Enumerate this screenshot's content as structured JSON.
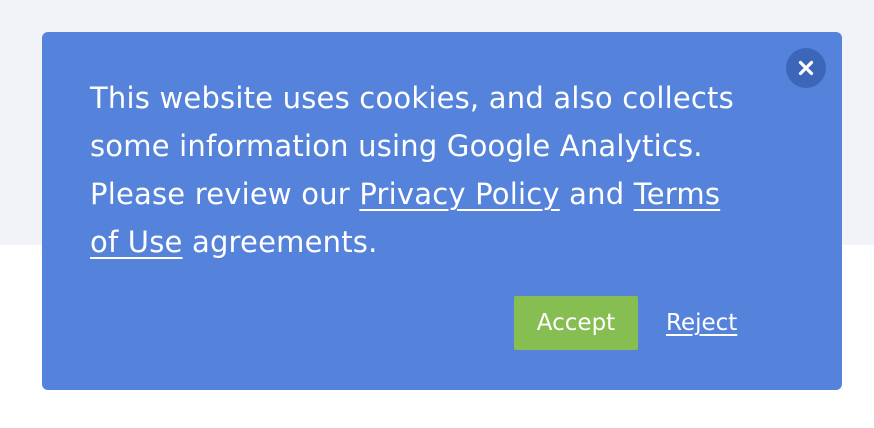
{
  "cookie_banner": {
    "message_intro": "This website uses cookies, and also collects some information using Google Analytics. Please review our ",
    "privacy_link": "Privacy Policy",
    "message_and": " and ",
    "terms_link": "Terms of Use",
    "message_outro": " agreements.",
    "accept_label": "Accept",
    "reject_label": "Reject",
    "close_icon": "close-icon"
  },
  "colors": {
    "page_band": "#f2f3f8",
    "banner_background": "#5583db",
    "close_button": "#3c66b7",
    "accept_button": "#86be52",
    "text": "#ffffff"
  }
}
